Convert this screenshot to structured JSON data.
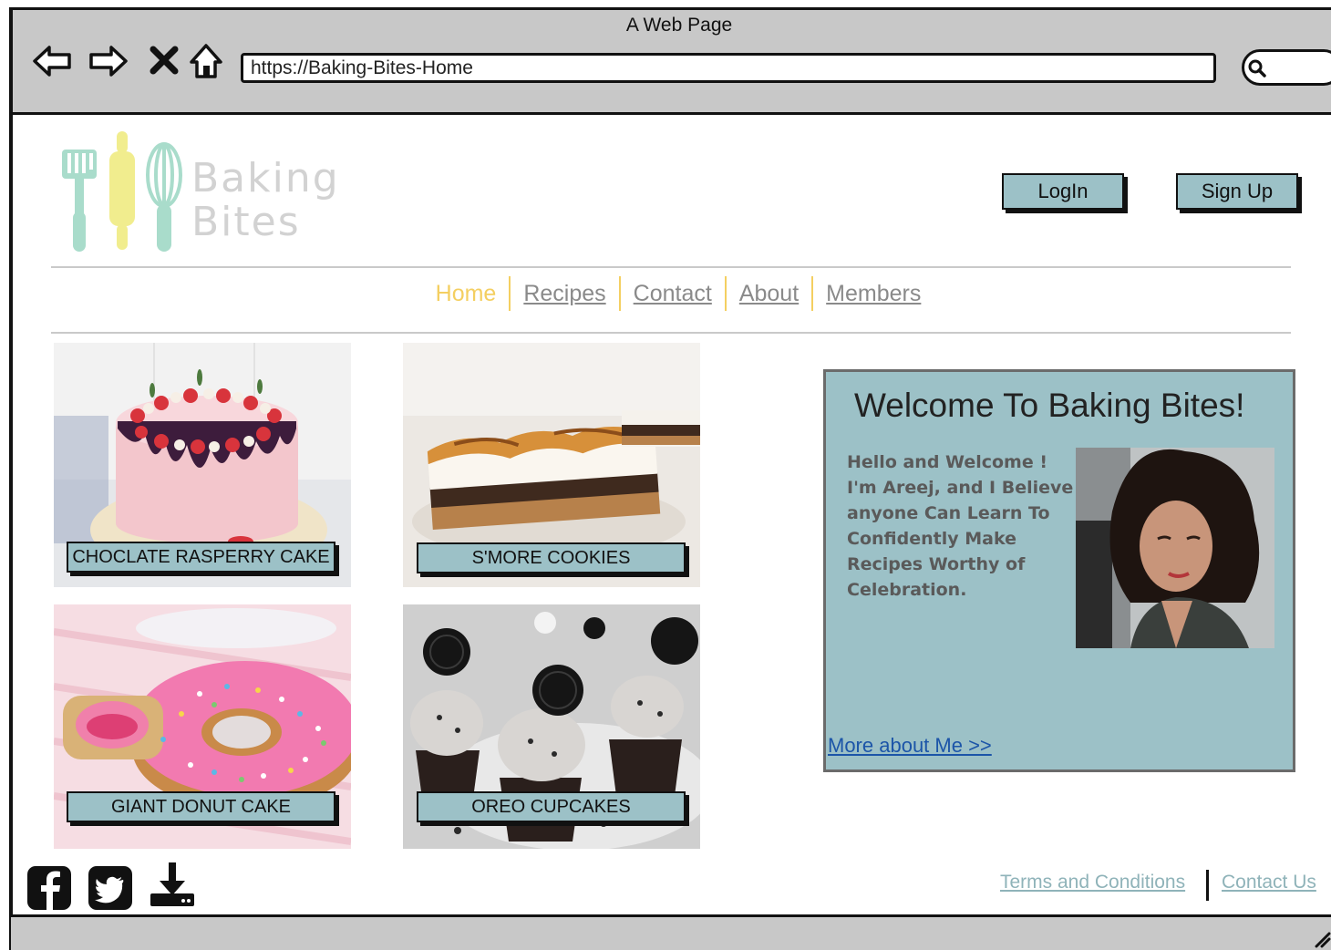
{
  "window": {
    "title": "A Web Page",
    "url": "https://Baking-Bites-Home"
  },
  "toolbar": {
    "back_icon": "back-arrow-icon",
    "forward_icon": "forward-arrow-icon",
    "stop_icon": "close-icon",
    "home_icon": "home-icon",
    "search_icon": "search-icon"
  },
  "brand": {
    "line1": "Baking",
    "line2": "Bites"
  },
  "auth": {
    "login_label": "LogIn",
    "signup_label": "Sign Up"
  },
  "nav": {
    "items": [
      "Home",
      "Recipes",
      "Contact",
      "About",
      "Members"
    ],
    "active": "Home"
  },
  "products": [
    {
      "label": "CHOCLATE RASPERRY CAKE"
    },
    {
      "label": "S'MORE COOKIES"
    },
    {
      "label": "GIANT DONUT CAKE"
    },
    {
      "label": "OREO CUPCAKES"
    }
  ],
  "welcome": {
    "title": "Welcome To Baking Bites!",
    "text": "Hello and Welcome ! I'm Areej, and I Believe anyone Can Learn To Confidently Make Recipes Worthy of Celebration.",
    "more_link": "More about Me >>"
  },
  "footer": {
    "social": [
      "facebook-icon",
      "twitter-icon",
      "download-icon"
    ],
    "links": [
      "Terms and Conditions",
      "Contact Us"
    ]
  },
  "colors": {
    "accent": "#9cc1c7",
    "nav_active": "#f4cf61",
    "link": "#1c55a8",
    "footer_link": "#8fb3b9"
  }
}
